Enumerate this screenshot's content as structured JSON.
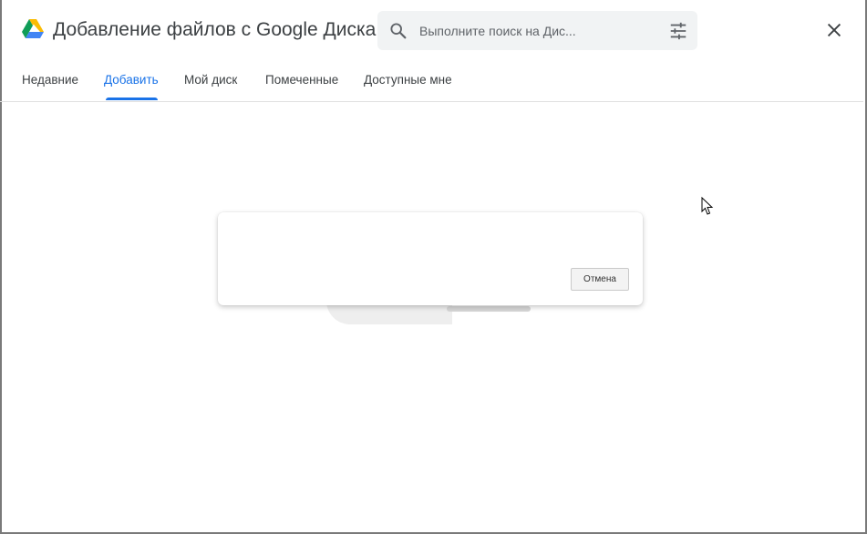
{
  "header": {
    "title": "Добавление файлов с Google Диска",
    "logo_icon": "google-drive-logo"
  },
  "search": {
    "placeholder": "Выполните поиск на Дис...",
    "search_icon": "search-icon",
    "filter_icon": "tune-icon"
  },
  "close_icon": "close-icon",
  "tabs": [
    {
      "label": "Недавние",
      "active": false
    },
    {
      "label": "Добавить",
      "active": true
    },
    {
      "label": "Мой диск",
      "active": false
    },
    {
      "label": "Помеченные",
      "active": false
    },
    {
      "label": "Доступные мне",
      "active": false
    }
  ],
  "dialog": {
    "cancel_label": "Отмена"
  },
  "colors": {
    "accent": "#1a73e8",
    "text": "#3c4043",
    "search_bg": "#f1f3f4"
  }
}
